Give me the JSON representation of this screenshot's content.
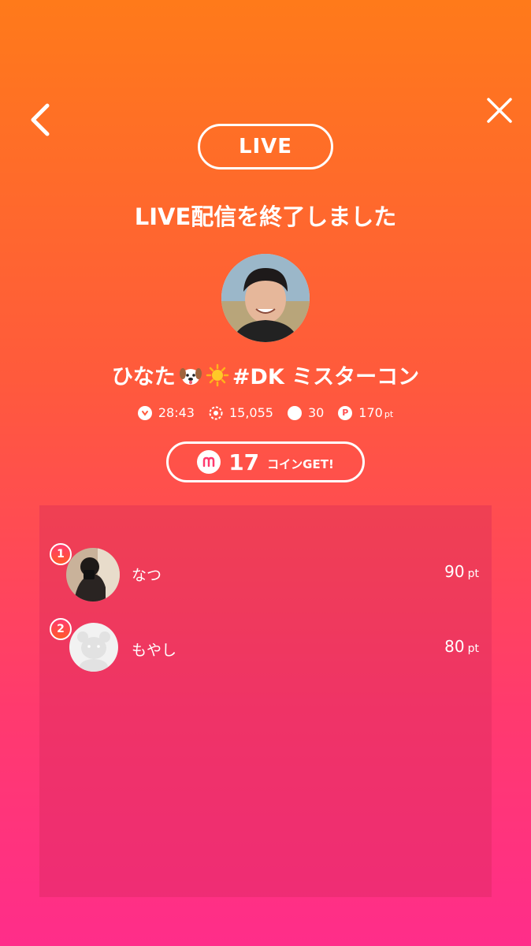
{
  "header": {
    "back_icon": "chevron-left-icon",
    "close_icon": "close-icon",
    "live_badge": "LIVE"
  },
  "title": "LIVE配信を終了しました",
  "streamer": {
    "name_prefix": "ひなた",
    "name_suffix": "#DK ミスターコン",
    "emoji_1": "dog-face-icon",
    "emoji_2": "sun-icon"
  },
  "stats": {
    "duration": "28:43",
    "views": "15,055",
    "comments": "30",
    "points": "170",
    "points_unit": "pt"
  },
  "coins": {
    "amount": "17",
    "label": "コインGET!"
  },
  "ranking": [
    {
      "rank": "1",
      "name": "なつ",
      "points": "90",
      "unit": "pt"
    },
    {
      "rank": "2",
      "name": "もやし",
      "points": "80",
      "unit": "pt"
    }
  ],
  "colors": {
    "gradient_top": "#FF7A1A",
    "gradient_bottom": "#FF2D8A",
    "panel": "#D8285A"
  }
}
